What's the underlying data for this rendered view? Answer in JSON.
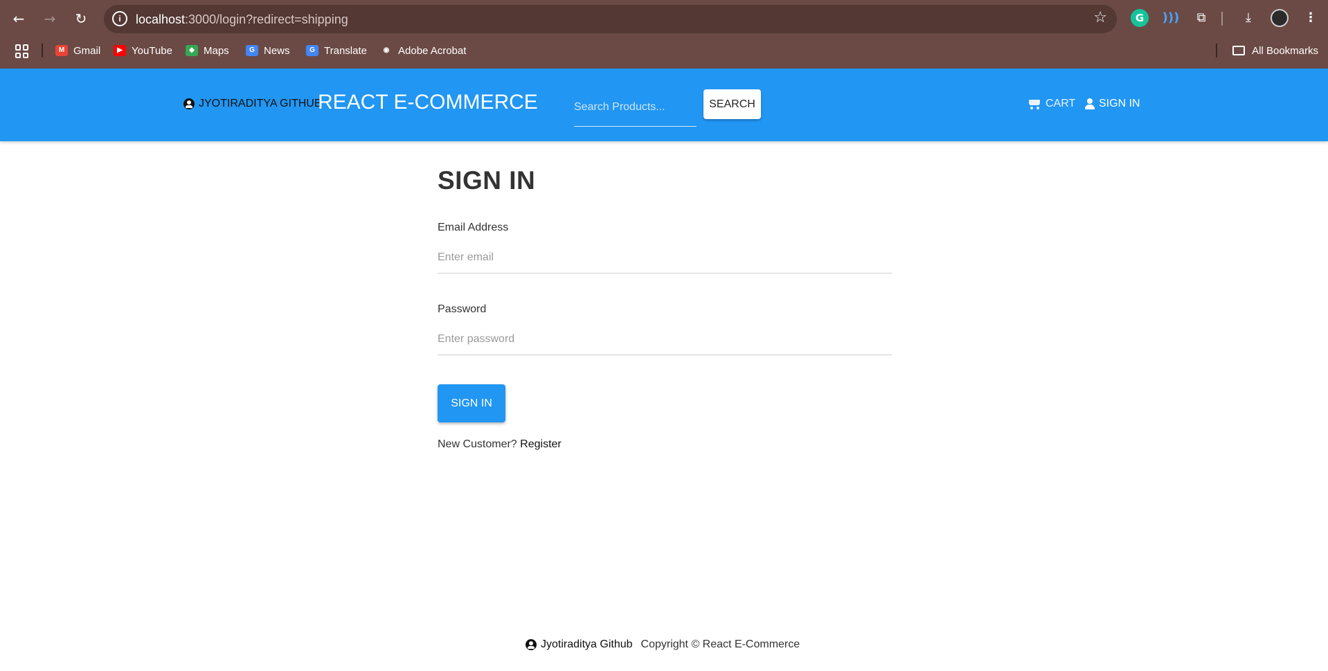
{
  "browser": {
    "url_host": "localhost",
    "url_path": ":3000/login?redirect=shipping",
    "bookmarks": [
      {
        "label": "Gmail",
        "icon": "gmail-icon",
        "color": "#ea4335",
        "glyph": "M"
      },
      {
        "label": "YouTube",
        "icon": "youtube-icon",
        "color": "#ff0000",
        "glyph": "▶"
      },
      {
        "label": "Maps",
        "icon": "maps-icon",
        "color": "#34a853",
        "glyph": "◆"
      },
      {
        "label": "News",
        "icon": "news-icon",
        "color": "#4285f4",
        "glyph": "G"
      },
      {
        "label": "Translate",
        "icon": "translate-icon",
        "color": "#4285f4",
        "glyph": "G"
      },
      {
        "label": "Adobe Acrobat",
        "icon": "globe-icon",
        "color": "#ffffff",
        "glyph": "◉"
      }
    ],
    "all_bookmarks_label": "All Bookmarks"
  },
  "header": {
    "github_link": "JYOTIRADITYA GITHUB",
    "brand": "REACT E-COMMERCE",
    "search_placeholder": "Search Products...",
    "search_button": "SEARCH",
    "cart_label": "CART",
    "signin_label": "SIGN IN",
    "accent_color": "#2196f3"
  },
  "form": {
    "title": "SIGN IN",
    "email_label": "Email Address",
    "email_placeholder": "Enter email",
    "password_label": "Password",
    "password_placeholder": "Enter password",
    "submit_label": "SIGN IN",
    "new_customer_text": "New Customer? ",
    "register_link": "Register"
  },
  "footer": {
    "github_link": "Jyotiraditya Github",
    "copyright": "Copyright © React E-Commerce"
  }
}
